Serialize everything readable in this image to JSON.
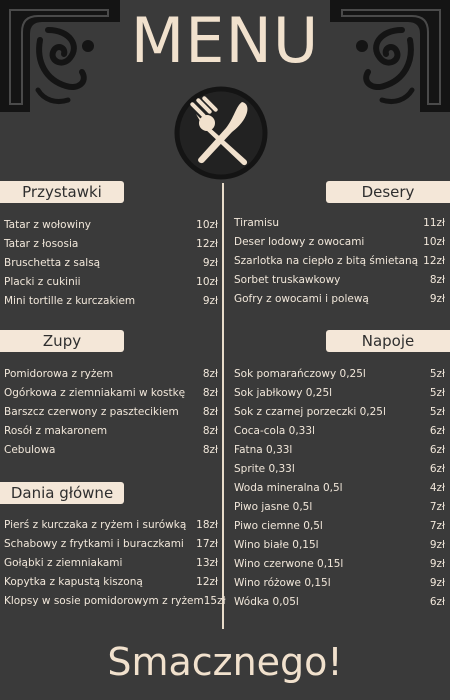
{
  "title": "MENU",
  "footer": "Smacznego!",
  "sections": {
    "przystawki": {
      "label": "Przystawki",
      "items": [
        {
          "name": "Tatar z wołowiny",
          "price": "10zł"
        },
        {
          "name": "Tatar z łososia",
          "price": "12zł"
        },
        {
          "name": "Bruschetta z salsą",
          "price": "9zł"
        },
        {
          "name": "Placki z cukinii",
          "price": "10zł"
        },
        {
          "name": "Mini tortille z kurczakiem",
          "price": "9zł"
        }
      ]
    },
    "zupy": {
      "label": "Zupy",
      "items": [
        {
          "name": "Pomidorowa z ryżem",
          "price": "8zł"
        },
        {
          "name": "Ogórkowa z ziemniakami w kostkę",
          "price": "8zł"
        },
        {
          "name": "Barszcz czerwony z pasztecikiem",
          "price": "8zł"
        },
        {
          "name": "Rosół z makaronem",
          "price": "8zł"
        },
        {
          "name": "Cebulowa",
          "price": "8zł"
        }
      ]
    },
    "dania": {
      "label": "Dania główne",
      "items": [
        {
          "name": "Pierś z kurczaka z ryżem i surówką",
          "price": "18zł"
        },
        {
          "name": "Schabowy z frytkami i buraczkami",
          "price": "17zł"
        },
        {
          "name": "Gołąbki z ziemniakami",
          "price": "13zł"
        },
        {
          "name": "Kopytka z kapustą kiszoną",
          "price": "12zł"
        },
        {
          "name": "Klopsy w sosie pomidorowym z ryżem",
          "price": "15zł"
        }
      ]
    },
    "desery": {
      "label": "Desery",
      "items": [
        {
          "name": "Tiramisu",
          "price": "11zł"
        },
        {
          "name": "Deser lodowy z owocami",
          "price": "10zł"
        },
        {
          "name": "Szarlotka na ciepło z bitą śmietaną",
          "price": "12zł"
        },
        {
          "name": "Sorbet truskawkowy",
          "price": "8zł"
        },
        {
          "name": "Gofry z owocami i polewą",
          "price": "9zł"
        }
      ]
    },
    "napoje": {
      "label": "Napoje",
      "items": [
        {
          "name": "Sok pomarańczowy 0,25l",
          "price": "5zł"
        },
        {
          "name": "Sok jabłkowy 0,25l",
          "price": "5zł"
        },
        {
          "name": "Sok z czarnej porzeczki 0,25l",
          "price": "5zł"
        },
        {
          "name": "Coca-cola 0,33l",
          "price": "6zł"
        },
        {
          "name": "Fatna 0,33l",
          "price": "6zł"
        },
        {
          "name": "Sprite 0,33l",
          "price": "6zł"
        },
        {
          "name": "Woda mineralna 0,5l",
          "price": "4zł"
        },
        {
          "name": "Piwo jasne 0,5l",
          "price": "7zł"
        },
        {
          "name": "Piwo ciemne 0,5l",
          "price": "7zł"
        },
        {
          "name": "Wino białe 0,15l",
          "price": "9zł"
        },
        {
          "name": "Wino czerwone 0,15l",
          "price": "9zł"
        },
        {
          "name": "Wino różowe 0,15l",
          "price": "9zł"
        },
        {
          "name": "Wódka 0,05l",
          "price": "6zł"
        }
      ]
    }
  },
  "icons": [
    "ornament-corner-icon",
    "fork-knife-icon"
  ]
}
